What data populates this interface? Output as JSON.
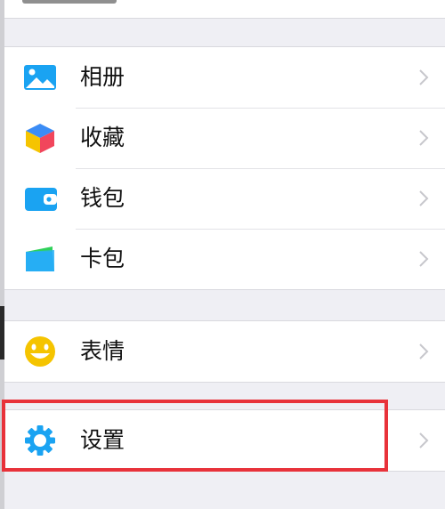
{
  "menu": {
    "group1": [
      {
        "label": "相册",
        "icon": "photo-album-icon"
      },
      {
        "label": "收藏",
        "icon": "favorites-cube-icon"
      },
      {
        "label": "钱包",
        "icon": "wallet-icon"
      },
      {
        "label": "卡包",
        "icon": "card-pack-icon"
      }
    ],
    "group2": [
      {
        "label": "表情",
        "icon": "smiley-face-icon"
      }
    ],
    "group3": [
      {
        "label": "设置",
        "icon": "gear-icon"
      }
    ]
  },
  "colors": {
    "accent_blue": "#1aa3f2",
    "highlight_red": "#e8323a",
    "smiley_yellow": "#f5c400",
    "card_green": "#2fd15a"
  }
}
